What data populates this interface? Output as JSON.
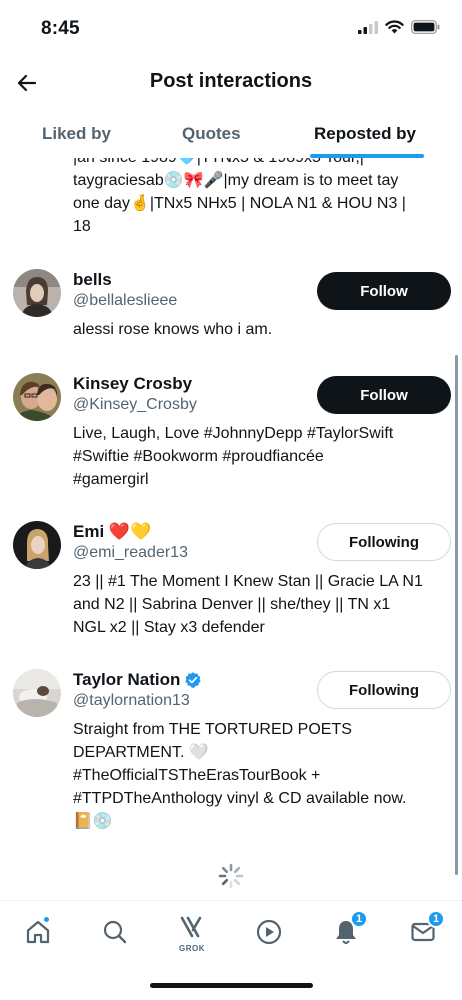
{
  "status_bar": {
    "time": "8:45"
  },
  "header": {
    "title": "Post interactions"
  },
  "tabs": [
    {
      "label": "Liked by",
      "active": false
    },
    {
      "label": "Quotes",
      "active": false
    },
    {
      "label": "Reposted by",
      "active": true
    }
  ],
  "partial_bio": {
    "line1": "|an since 1989🩵|TTNx5 & 1989x5 Tour,|",
    "line2": "taygraciesab💿🎀🎤|my dream is to meet tay",
    "line3": "one day🤞|TNx5 NHx5 | NOLA N1 & HOU N3 |",
    "line4": "18"
  },
  "users": [
    {
      "name": "bells",
      "handle": "@bellaleslieee",
      "button": "Follow",
      "bio": [
        "alessi rose knows who i am."
      ]
    },
    {
      "name": "Kinsey Crosby",
      "handle": "@Kinsey_Crosby",
      "button": "Follow",
      "bio": [
        "Live, Laugh, Love #JohnnyDepp #TaylorSwift",
        "#Swiftie #Bookworm #proudfiancée",
        "#gamergirl"
      ]
    },
    {
      "name": "Emi ❤️💛",
      "handle": "@emi_reader13",
      "button": "Following",
      "bio": [
        "23 || #1 The Moment I Knew Stan || Gracie LA N1",
        "and N2 || Sabrina Denver || she/they || TN x1",
        "NGL x2 || Stay x3 defender"
      ]
    },
    {
      "name": "Taylor Nation",
      "handle": "@taylornation13",
      "button": "Following",
      "verified": true,
      "bio": [
        "Straight from THE TORTURED POETS",
        "DEPARTMENT. 🤍",
        "#TheOfficialTSTheErasTourBook +",
        "#TTPDTheAnthology vinyl & CD available now.",
        "📔💿"
      ]
    }
  ],
  "bottom_nav": {
    "grok_label": "GROK",
    "notifications_badge": "1",
    "messages_badge": "1"
  },
  "colors": {
    "accent": "#1d9bf0",
    "text": "#0f1419",
    "secondary": "#536471"
  }
}
